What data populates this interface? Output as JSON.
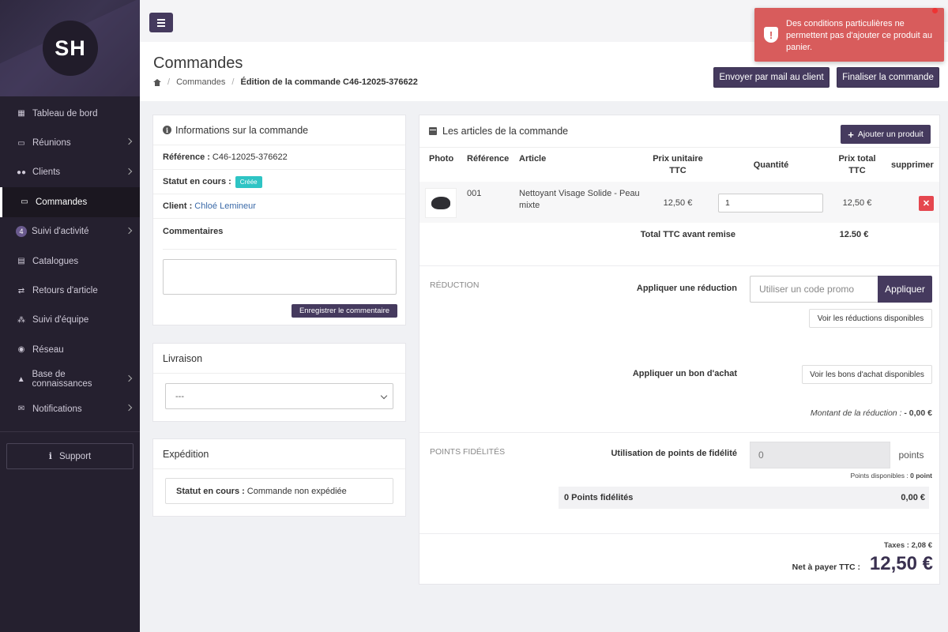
{
  "sidebar": {
    "logo_text": "SH",
    "items": [
      {
        "label": "Tableau de bord",
        "icon": "dashboard-icon",
        "has_children": false
      },
      {
        "label": "Réunions",
        "icon": "calendar-icon",
        "has_children": true
      },
      {
        "label": "Clients",
        "icon": "users-icon",
        "has_children": true
      },
      {
        "label": "Commandes",
        "icon": "credit-card-icon",
        "has_children": false,
        "active": true
      },
      {
        "label": "Suivi d'activité",
        "icon": "badge-number",
        "badge": "4",
        "has_children": true
      },
      {
        "label": "Catalogues",
        "icon": "book-icon",
        "has_children": false
      },
      {
        "label": "Retours d'article",
        "icon": "exchange-icon",
        "has_children": false
      },
      {
        "label": "Suivi d'équipe",
        "icon": "sitemap-icon",
        "has_children": false
      },
      {
        "label": "Réseau",
        "icon": "globe-icon",
        "has_children": false
      },
      {
        "label": "Base de connaissances",
        "icon": "graduation-cap-icon",
        "has_children": true
      },
      {
        "label": "Notifications",
        "icon": "envelope-icon",
        "has_children": true
      }
    ],
    "support_label": "Support"
  },
  "header": {
    "title": "Commandes",
    "breadcrumb": {
      "home_icon": "home-icon",
      "section": "Commandes",
      "current": "Édition de la commande C46-12025-376622"
    },
    "btn_mail": "Envoyer par mail au client",
    "btn_finalize": "Finaliser la commande"
  },
  "toast": {
    "message": "Des conditions particulières ne permettent pas d'ajouter ce produit au panier.",
    "color": "#d85c5c"
  },
  "order_info": {
    "title": "Informations sur la commande",
    "reference_label": "Référence :",
    "reference_value": "C46-12025-376622",
    "status_label": "Statut en cours :",
    "status_value": "Créée",
    "client_label": "Client :",
    "client_value": "Chloé Lemineur",
    "comments_label": "Commentaires",
    "comment_value": "",
    "save_comment_label": "Enregistrer le commentaire"
  },
  "delivery": {
    "title": "Livraison",
    "selected": "---"
  },
  "shipping": {
    "title": "Expédition",
    "status_label": "Statut en cours :",
    "status_value": "Commande non expédiée"
  },
  "articles": {
    "title": "Les articles de la commande",
    "add_product_label": "Ajouter un produit",
    "columns": {
      "photo": "Photo",
      "reference": "Référence",
      "article": "Article",
      "unit_price": "Prix unitaire TTC",
      "quantity": "Quantité",
      "total_price": "Prix total TTC",
      "delete": "supprimer"
    },
    "items": [
      {
        "reference": "001",
        "article": "Nettoyant Visage Solide - Peau mixte",
        "unit_price": "12,50 €",
        "quantity": "1",
        "total_price": "12,50 €"
      }
    ],
    "total_before_discount_label": "Total TTC avant remise",
    "total_before_discount_value": "12.50 €"
  },
  "reduction": {
    "section_label": "RÉDUCTION",
    "apply_reduction_label": "Appliquer une réduction",
    "promo_placeholder": "Utiliser un code promo",
    "apply_button": "Appliquer",
    "see_reductions": "Voir les réductions disponibles",
    "apply_voucher_label": "Appliquer un bon d'achat",
    "see_vouchers": "Voir les bons d'achat disponibles",
    "amount_label": "Montant de la réduction :",
    "amount_value": "- 0,00 €"
  },
  "loyalty": {
    "section_label": "POINTS FIDÉLITÉS",
    "use_points_label": "Utilisation de points de fidélité",
    "points_value": "0",
    "points_addon": "points",
    "available_label": "Points disponibles :",
    "available_value": "0 point",
    "total_points_label": "0 Points fidélités",
    "total_points_value": "0,00 €"
  },
  "totals": {
    "taxes_label": "Taxes :",
    "taxes_value": "2,08 €",
    "net_label": "Net à payer TTC :",
    "net_value": "12,50 €"
  }
}
